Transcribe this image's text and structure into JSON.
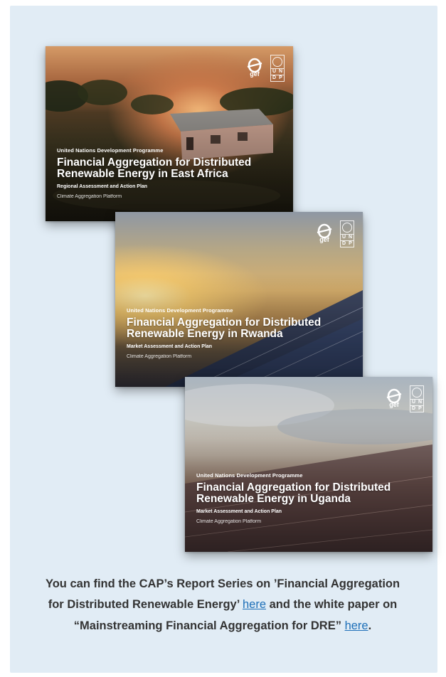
{
  "reports": [
    {
      "org": "United Nations Development Programme",
      "title": "Financial Aggregation for Distributed Renewable Energy in East Africa",
      "subtitle": "Regional Assessment and Action Plan",
      "platform": "Climate Aggregation Platform",
      "logo_gef": "gef",
      "logo_undp": [
        "U",
        "N",
        "D",
        "P"
      ]
    },
    {
      "org": "United Nations Development Programme",
      "title": "Financial Aggregation for Distributed Renewable Energy in Rwanda",
      "subtitle": "Market Assessment and Action Plan",
      "platform": "Climate Aggregation Platform",
      "logo_gef": "gef",
      "logo_undp": [
        "U",
        "N",
        "D",
        "P"
      ]
    },
    {
      "org": "United Nations Development Programme",
      "title": "Financial Aggregation for Distributed Renewable Energy in Uganda",
      "subtitle": "Market Assessment and Action Plan",
      "platform": "Climate Aggregation Platform",
      "logo_gef": "gef",
      "logo_undp": [
        "U",
        "N",
        "D",
        "P"
      ]
    }
  ],
  "caption": {
    "part1": "You can find the CAP’s Report Series  on ’Financial Aggregation for Distributed Renewable Energy’ ",
    "link1": "here",
    "part2": " and the white paper on “Mainstreaming Financial Aggregation for DRE” ",
    "link2": "here",
    "part3": "."
  },
  "colors": {
    "panel_bg": "#e1ecf5",
    "caption_text": "#333333",
    "link": "#1d6fb8"
  }
}
